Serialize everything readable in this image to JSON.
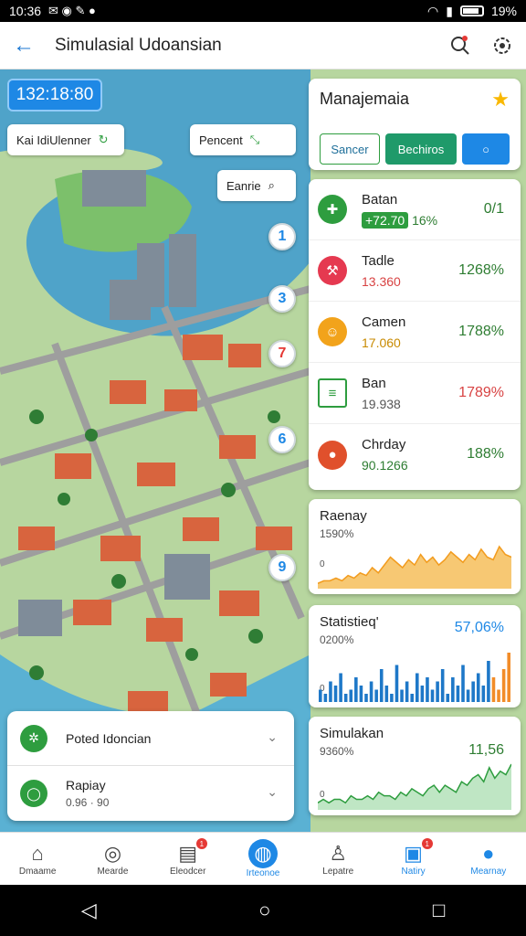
{
  "status_bar": {
    "time": "10:36",
    "battery": "19%"
  },
  "app_bar": {
    "title": "Simulasial Udoansian"
  },
  "map": {
    "clock": "132:18:80",
    "chip_left": "Kai IdiUlenner",
    "chip_right": "Pencent",
    "chip_search": "Eanrie",
    "pins": [
      "1",
      "3",
      "7",
      "6",
      "9"
    ]
  },
  "management": {
    "title": "Manajemaia",
    "btn_outline": "Sancer",
    "btn_fill": "Bechiros"
  },
  "resources": [
    {
      "name": "Batan",
      "value": "+72.70",
      "extra": "16%",
      "pct": "0/1",
      "color": "#2e9d3f",
      "pct_color": "#2e7d32"
    },
    {
      "name": "Tadle",
      "value": "13.360",
      "pct": "1268%",
      "color": "#e53950",
      "pct_color": "#2e7d32"
    },
    {
      "name": "Camen",
      "value": "17.060",
      "pct": "1788%",
      "color": "#f2a31b",
      "pct_color": "#2e7d32"
    },
    {
      "name": "Ban",
      "value": "19.938",
      "pct": "1789%",
      "color": "#2e9d3f",
      "pct_color": "#d84343"
    },
    {
      "name": "Chrday",
      "value": "90.1266",
      "pct": "188%",
      "color": "#e0502c",
      "pct_color": "#2e7d32"
    }
  ],
  "chart_data": [
    {
      "type": "area",
      "title": "Raenay",
      "subtitle": "1590%",
      "ylabel": "0",
      "values": [
        2,
        3,
        3,
        4,
        3,
        5,
        4,
        6,
        5,
        8,
        6,
        9,
        12,
        10,
        8,
        11,
        9,
        13,
        10,
        12,
        9,
        11,
        14,
        12,
        10,
        13,
        11,
        15,
        12,
        11,
        16,
        13,
        12
      ]
    },
    {
      "type": "bar",
      "title": "Statistieq'",
      "subtitle": "0200%",
      "big": "57,06%",
      "ylabel": "0",
      "values": [
        3,
        2,
        5,
        4,
        7,
        2,
        3,
        6,
        4,
        2,
        5,
        3,
        8,
        4,
        2,
        9,
        3,
        5,
        2,
        7,
        4,
        6,
        3,
        5,
        8,
        2,
        6,
        4,
        9,
        3,
        5,
        7,
        4,
        10,
        6,
        3,
        8,
        12
      ]
    },
    {
      "type": "area",
      "title": "Simulakan",
      "subtitle": "9360%",
      "big": "11,56",
      "ylabel": "0",
      "values": [
        2,
        3,
        2,
        3,
        3,
        2,
        4,
        3,
        3,
        4,
        3,
        5,
        4,
        4,
        3,
        5,
        4,
        6,
        5,
        4,
        6,
        7,
        5,
        7,
        6,
        5,
        8,
        7,
        9,
        10,
        8,
        12,
        9,
        11,
        10,
        13
      ]
    }
  ],
  "bottom_sheet": [
    {
      "title": "Poted Idoncian"
    },
    {
      "title": "Rapiay",
      "detail": "0.96 · 90"
    }
  ],
  "bottom_nav": [
    "Dmaame",
    "Mearde",
    "Eleodcer",
    "Irteonoe",
    "Lepatre",
    "Natiry",
    "Mearnay"
  ],
  "colors": {
    "accent": "#1e88e5",
    "green": "#2e9d3f",
    "orange": "#f29c1f"
  }
}
